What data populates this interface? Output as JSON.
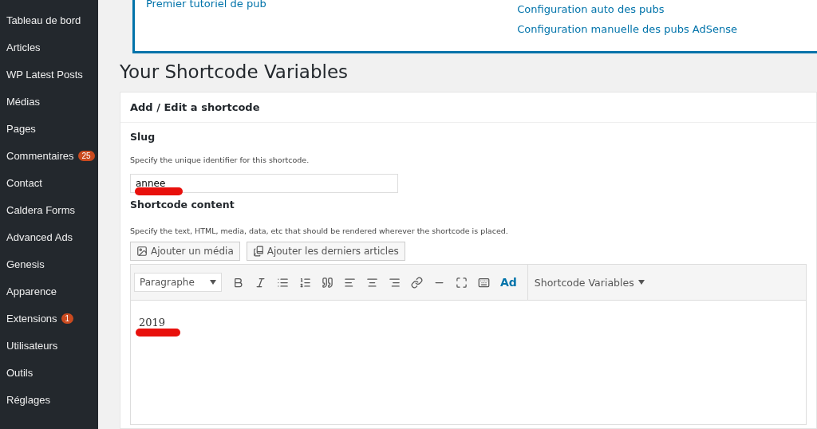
{
  "sidebar": {
    "items": [
      {
        "label": "Tableau de bord"
      },
      {
        "label": "Articles"
      },
      {
        "label": "WP Latest Posts"
      },
      {
        "label": "Médias"
      },
      {
        "label": "Pages"
      },
      {
        "label": "Commentaires",
        "badge": "25"
      },
      {
        "label": "Contact"
      },
      {
        "label": "Caldera Forms"
      },
      {
        "label": "Advanced Ads"
      },
      {
        "label": "Genesis"
      },
      {
        "label": "Apparence"
      },
      {
        "label": "Extensions",
        "badge": "1"
      },
      {
        "label": "Utilisateurs"
      },
      {
        "label": "Outils"
      },
      {
        "label": "Réglages"
      }
    ]
  },
  "notice": {
    "left_links": [
      "Premier tutoriel de pub"
    ],
    "right_links": [
      "Configuration auto des pubs",
      "Configuration manuelle des pubs AdSense"
    ]
  },
  "page_title": "Your Shortcode Variables",
  "card": {
    "title": "Add / Edit a shortcode",
    "slug": {
      "label": "Slug",
      "help": "Specify the unique identifier for this shortcode.",
      "value": "annee"
    },
    "content": {
      "label": "Shortcode content",
      "help": "Specify the text, HTML, media, data, etc that should be rendered wherever the shortcode is placed.",
      "media_buttons": [
        "Ajouter un média",
        "Ajouter les derniers articles"
      ],
      "toolbar": {
        "format": "Paragraphe",
        "ad_label": "Ad",
        "menu": "Shortcode Variables"
      },
      "body": "2019"
    }
  }
}
